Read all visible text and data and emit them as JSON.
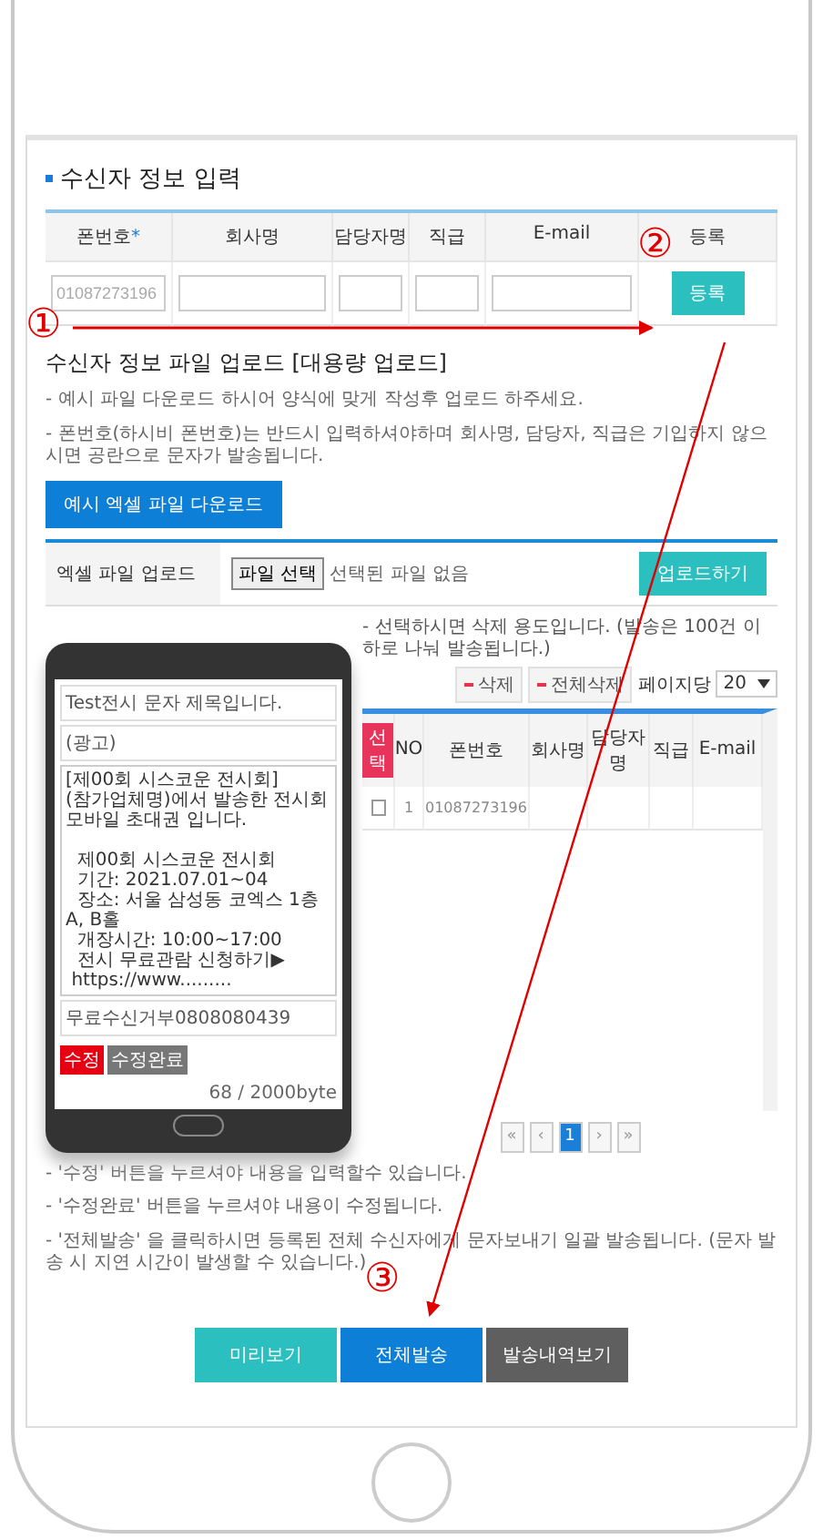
{
  "recipient_form": {
    "title": "수신자 정보 입력",
    "columns": [
      {
        "label": "폰번호",
        "mark": "*"
      },
      {
        "label": "회사명"
      },
      {
        "label": "담당자명"
      },
      {
        "label": "직급"
      },
      {
        "label": "E-mail"
      },
      {
        "label": "등록"
      }
    ],
    "phone_placeholder": "01087273196",
    "register_button": "등록"
  },
  "file_upload": {
    "title": "수신자 정보 파일 업로드 [대용량 업로드]",
    "notes": [
      "- 예시 파일 다운로드 하시어 양식에 맞게 작성후 업로드 하주세요.",
      "- 폰번호(하시비 폰번호)는 반드시 입력하셔야하며 회사명, 담당자, 직급은 기입하지 않으시면 공란으로 문자가 발송됩니다."
    ],
    "sample_button": "예시 엑셀 파일 다운로드",
    "upload_label": "엑셀 파일 업로드",
    "file_button": "파일 선택",
    "file_status": "선택된 파일 없음",
    "upload_button": "업로드하기"
  },
  "message_preview": {
    "subject": "Test전시 문자 제목입니다.",
    "ad_label": "(광고)",
    "body": "[제00회 시스코운 전시회]\n(참가업체명)에서 발송한 전시회 모바일 초대권 입니다.\n\n  제00회 시스코운 전시회\n  기간: 2021.07.01~04\n  장소: 서울 삼성동 코엑스 1층 A, B홀\n  개장시간: 10:00~17:00\n  전시 무료관람 신청하기▶\n https://www.........",
    "opt_out": "무료수신거부0808080439",
    "edit_button": "수정",
    "done_button": "수정완료",
    "byte_count": "68 / 2000byte"
  },
  "recipient_list": {
    "notice": "- 선택하시면 삭제 용도입니다. (발송은 100건 이하로 나눠 발송됩니다.)",
    "delete_button": "삭제",
    "delete_all_button": "전체삭제",
    "per_page_label": "페이지당",
    "per_page": "20",
    "columns": [
      "선택",
      "NO",
      "폰번호",
      "회사명",
      "담당자명",
      "직급",
      "E-mail"
    ],
    "rows": [
      {
        "checked": false,
        "no": "1",
        "phone": "01087273196"
      }
    ]
  },
  "pagination": [
    {
      "label": "«",
      "selected": false
    },
    {
      "label": "‹",
      "selected": false
    },
    {
      "label": "1",
      "selected": true
    },
    {
      "label": "›",
      "selected": false
    },
    {
      "label": "»",
      "selected": false
    }
  ],
  "notes": [
    "- '수정' 버튼을 누르셔야 내용을 입력할수 있습니다.",
    "- '수정완료' 버튼을 누르셔야 내용이 수정됩니다.",
    "- '전체발송' 을 클릭하시면 등록된 전체 수신자에게 문자보내기 일괄 발송됩니다. (문자 발송 시 지연 시간이 발생할 수 있습니다.)"
  ],
  "actions": [
    {
      "label": "미리보기",
      "kind": "preview"
    },
    {
      "label": "전체발송",
      "kind": "send"
    },
    {
      "label": "발송내역보기",
      "kind": "history"
    }
  ],
  "annotations": [
    {
      "label": "①"
    },
    {
      "label": "②"
    },
    {
      "label": "③"
    }
  ]
}
